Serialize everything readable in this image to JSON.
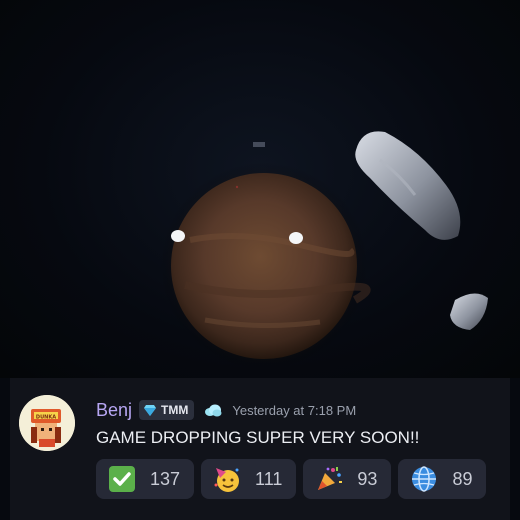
{
  "message": {
    "author": "Benj",
    "role_badge": "TMM",
    "role_badge_icon": "gem-icon",
    "extra_badge_icon": "cloud-icon",
    "timestamp": "Yesterday at 7:18 PM",
    "text": "GAME DROPPING SUPER VERY SOON!!",
    "avatar_text": "DUNKA"
  },
  "reactions": [
    {
      "icon": "check-mark-icon",
      "count": "137"
    },
    {
      "icon": "partying-face-icon",
      "count": "111"
    },
    {
      "icon": "party-popper-icon",
      "count": "93"
    },
    {
      "icon": "globe-icon",
      "count": "89"
    }
  ],
  "colors": {
    "username": "#b7a6f3",
    "message_bg": "#11131a",
    "reaction_bg": "#262936",
    "check_green": "#5bb04a"
  }
}
